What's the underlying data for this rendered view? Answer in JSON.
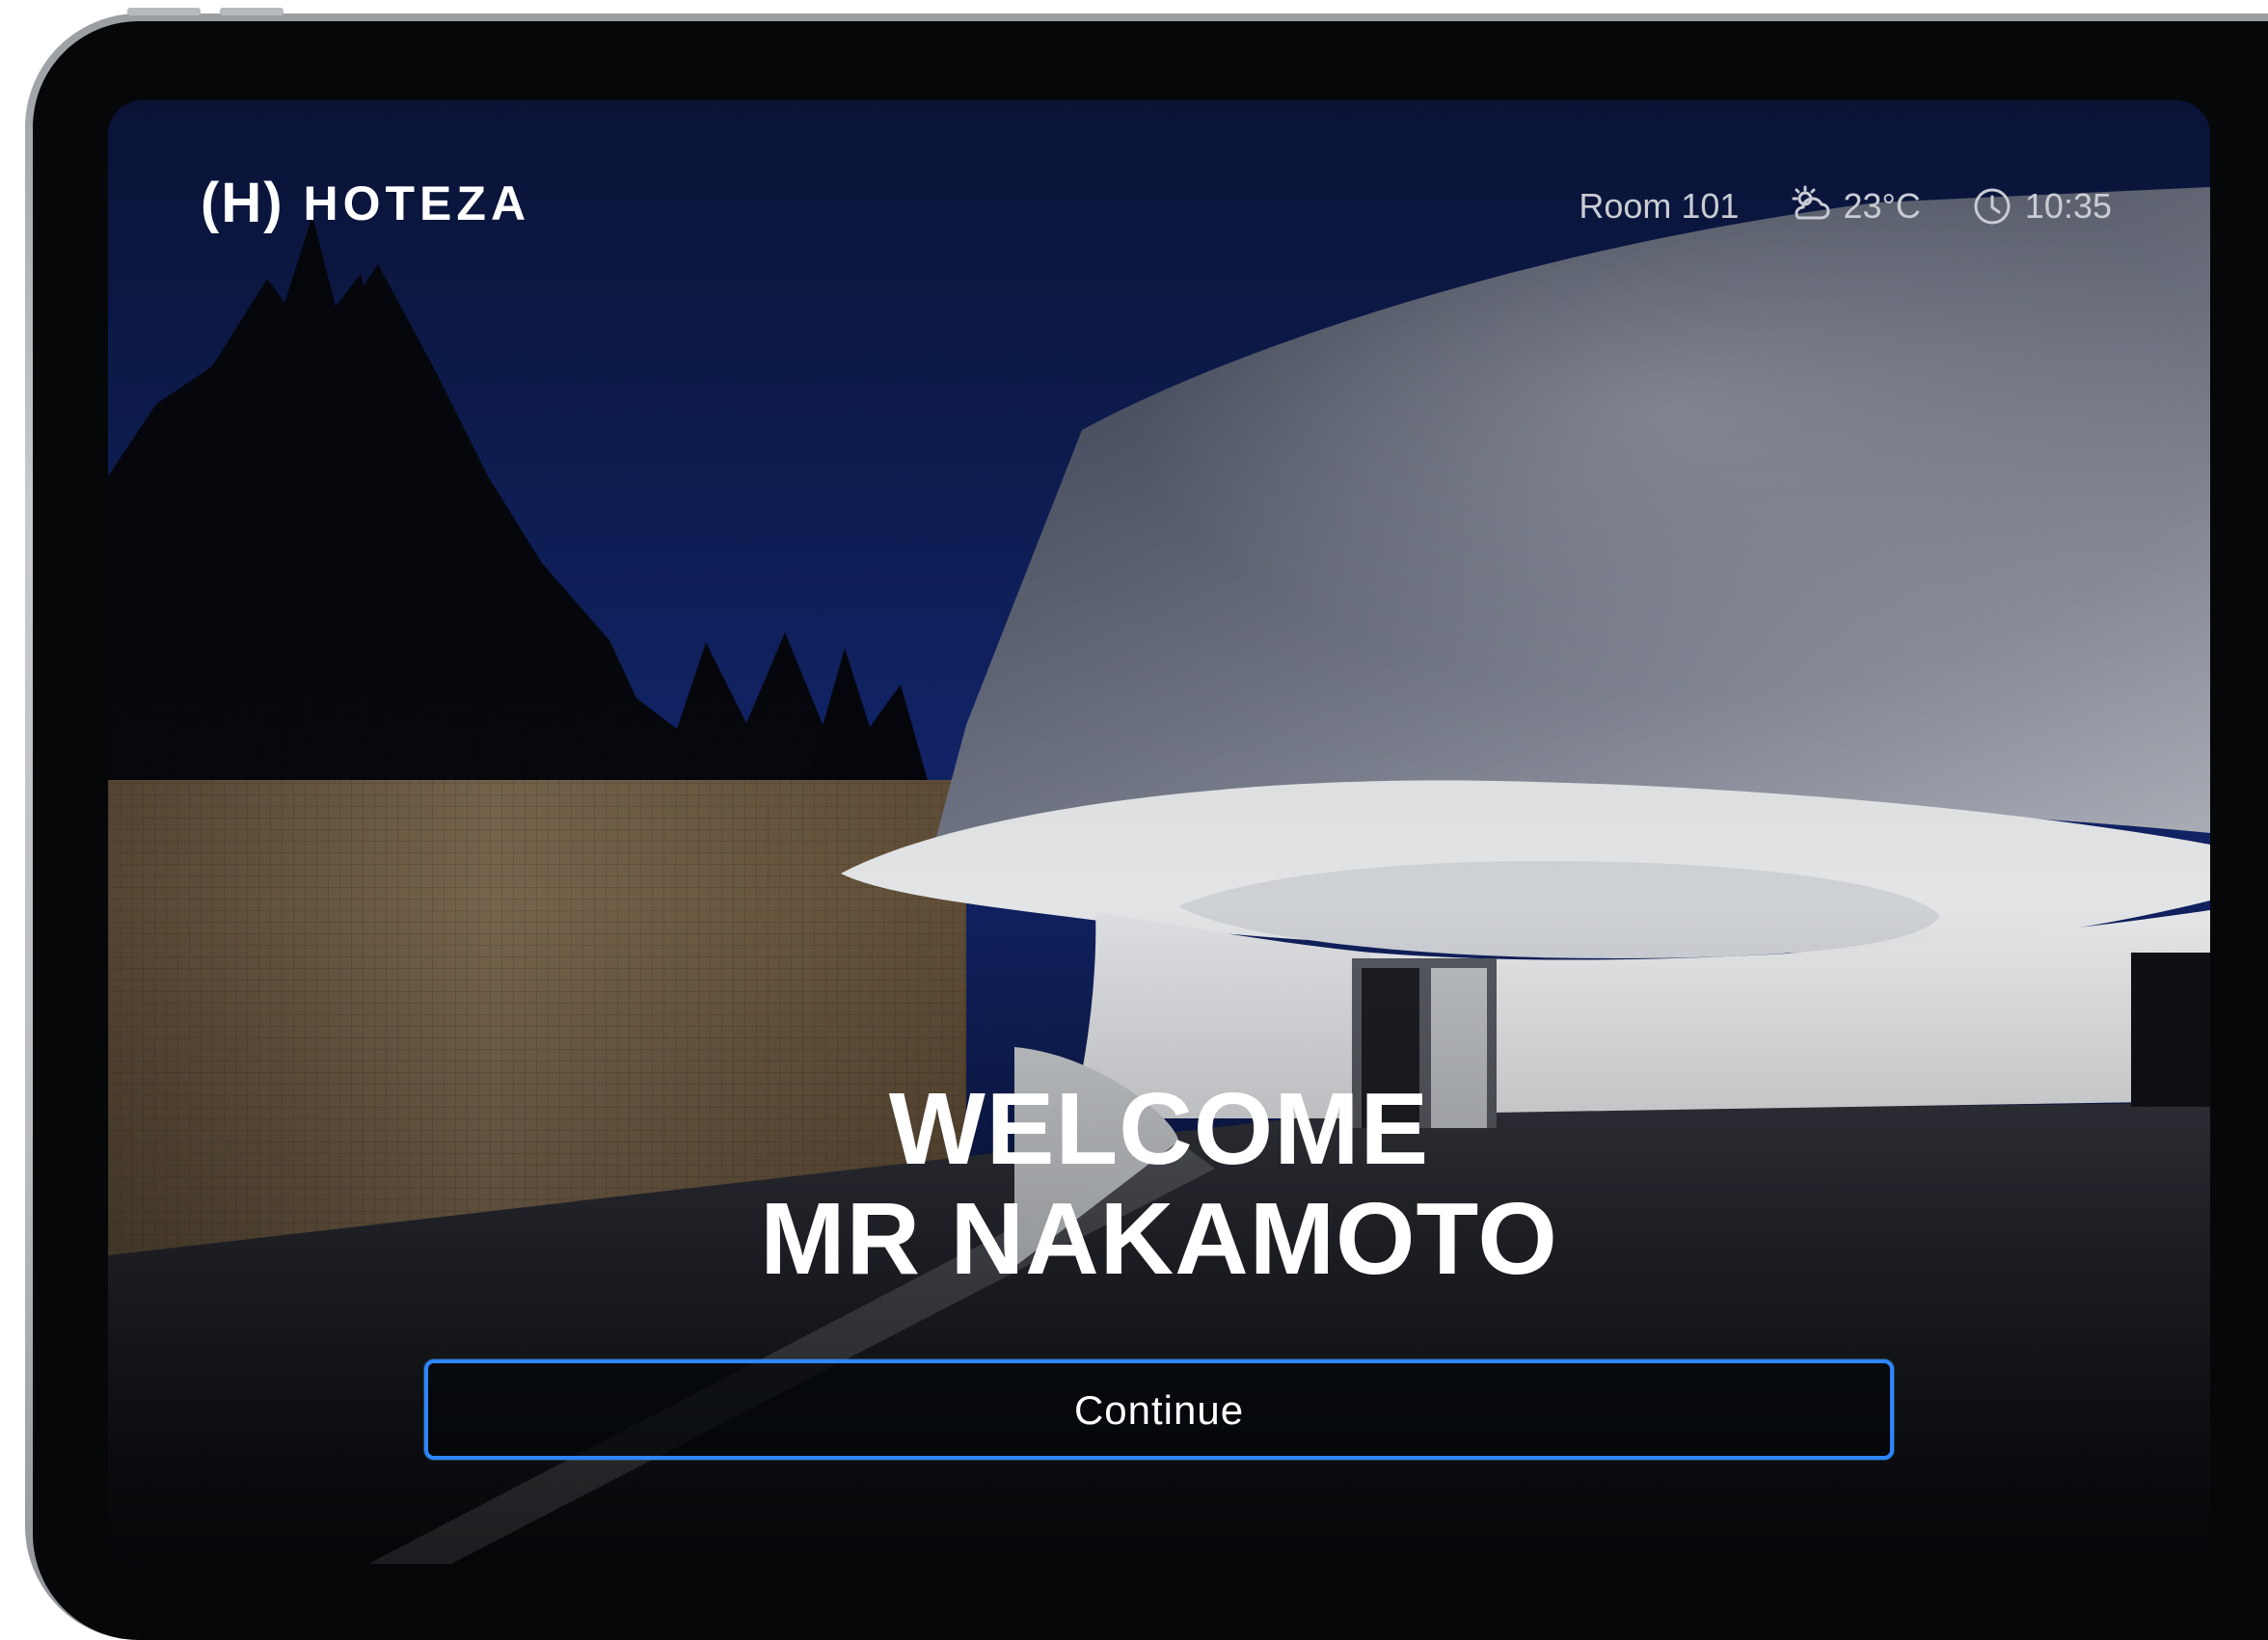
{
  "app": {
    "brand_mark": "(H)",
    "brand_name": "HOTEZA"
  },
  "status": {
    "room": "Room 101",
    "temperature": "23°C",
    "time": "10:35"
  },
  "welcome": {
    "line1": "WELCOME",
    "line2": "MR NAKAMOTO"
  },
  "actions": {
    "continue_label": "Continue"
  },
  "icons": {
    "weather": "partly-cloudy-icon",
    "clock": "clock-icon"
  },
  "colors": {
    "button_border": "#2f86ff",
    "text_primary": "#ffffff",
    "status_text": "#c9ccd3",
    "sky": "#0b1a4a"
  }
}
